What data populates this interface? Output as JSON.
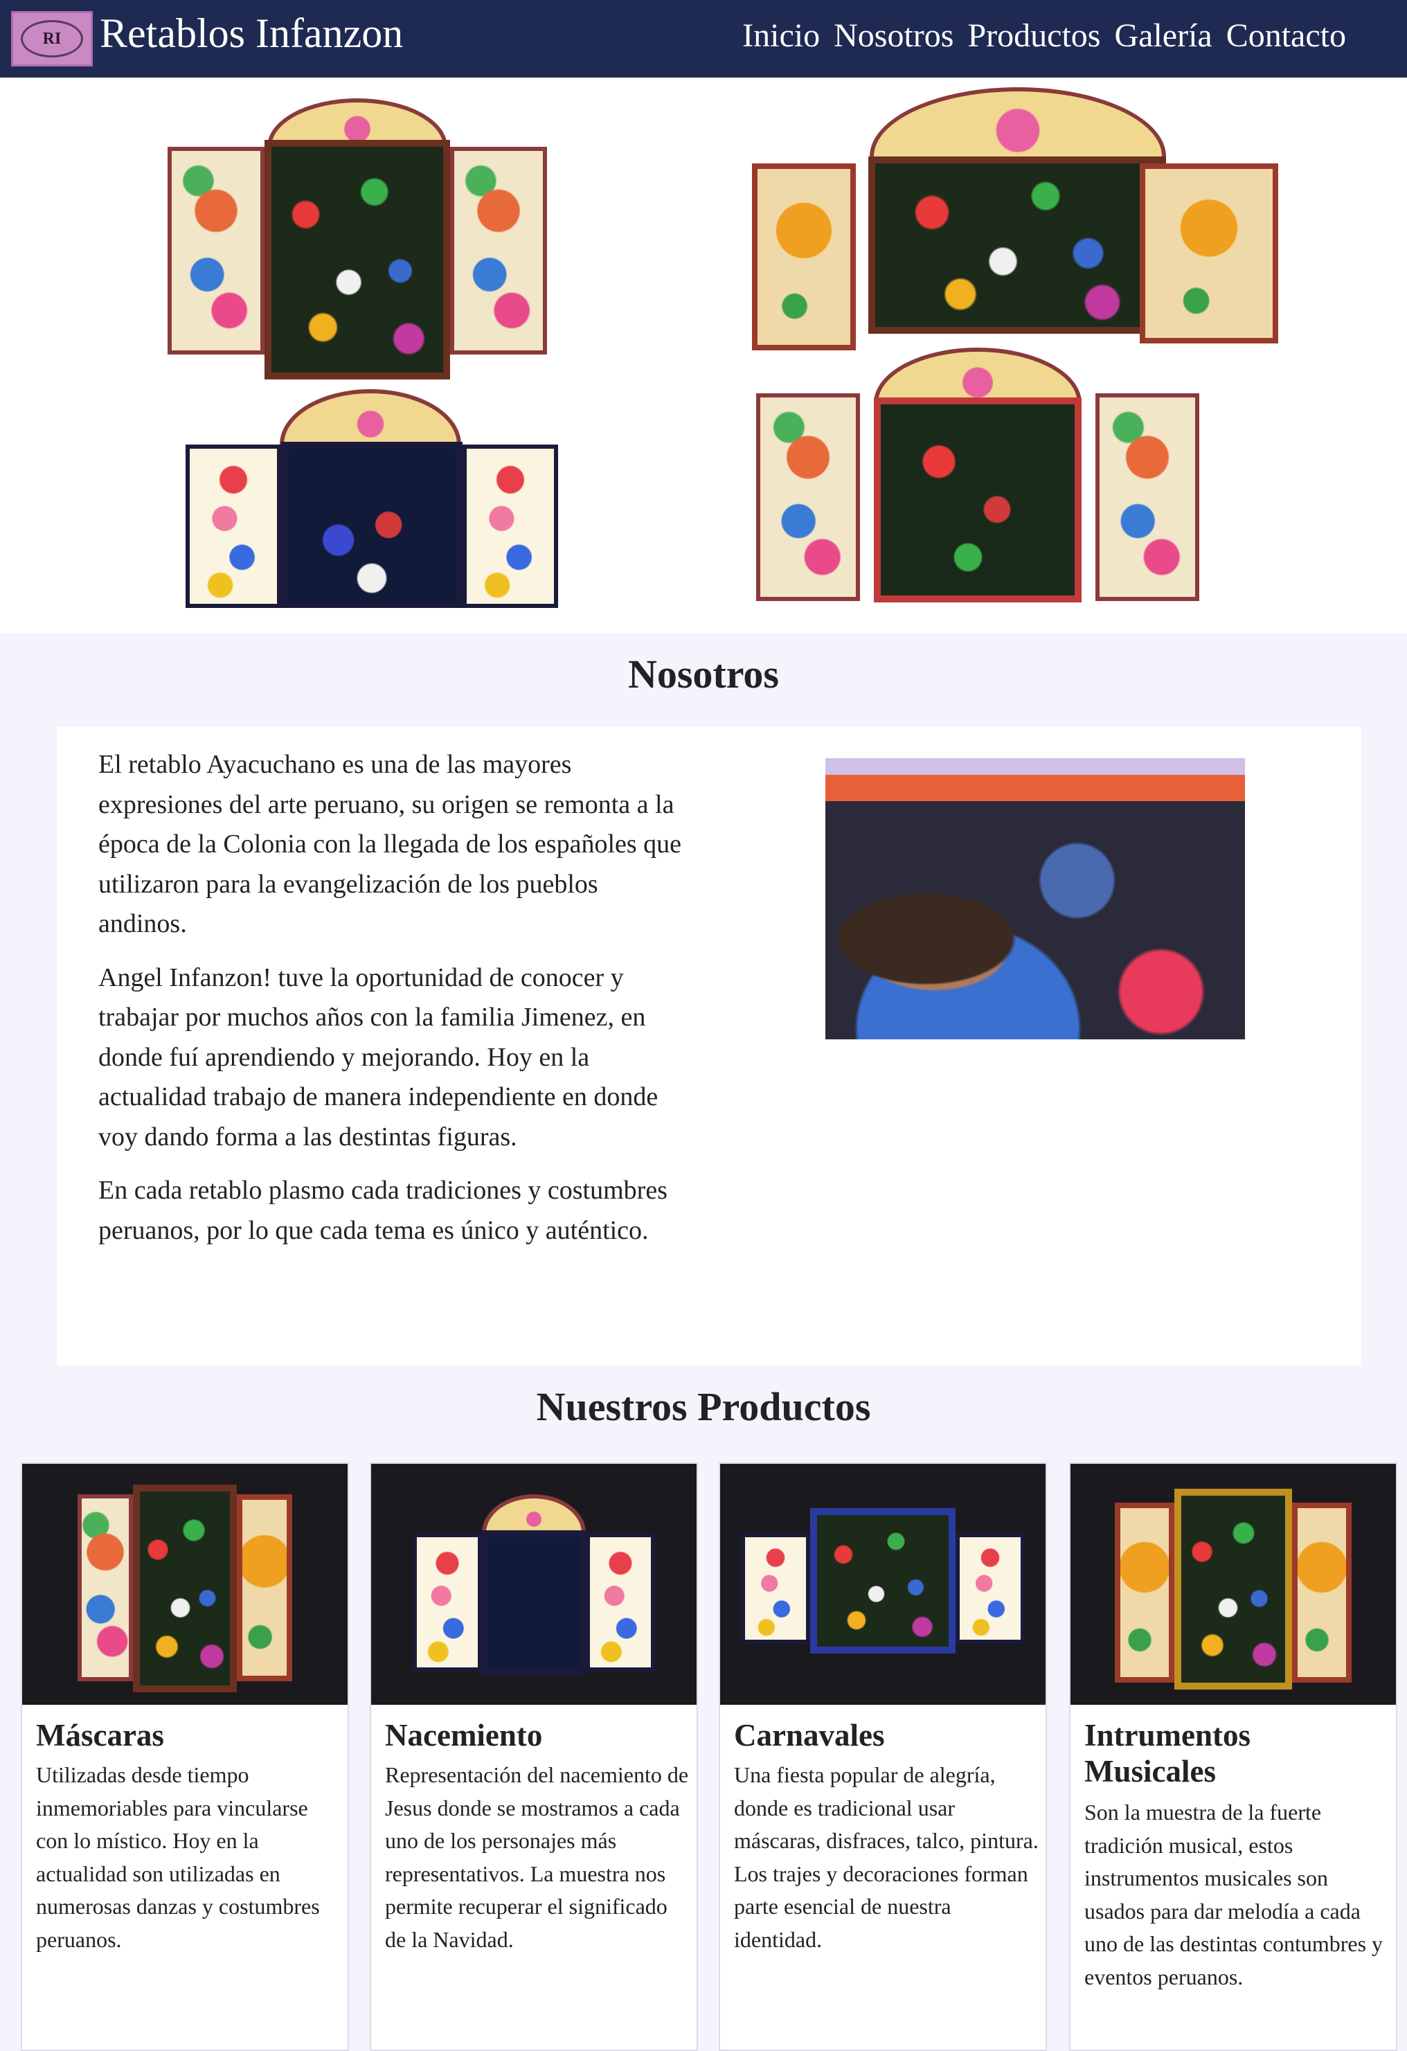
{
  "navbar": {
    "logo_text": "RI",
    "brand": "Retablos Infanzon",
    "links": [
      "Inicio",
      "Nosotros",
      "Productos",
      "Galería",
      "Contacto"
    ]
  },
  "about": {
    "title": "Nosotros",
    "paragraphs": [
      "El retablo Ayacuchano es una de las mayores expresiones del arte peruano, su origen se remonta a la época de la Colonia con la llegada de los españoles que utilizaron para la evangelización de los pueblos andinos.",
      "Angel Infanzon! tuve la oportunidad de conocer y trabajar por muchos años con la familia Jimenez, en donde fuí aprendiendo y mejorando. Hoy en la actualidad trabajo de manera independiente en donde voy dando forma a las destintas figuras.",
      "En cada retablo plasmo cada tradiciones y costumbres peruanos, por lo que cada tema es único y auténtico."
    ]
  },
  "products": {
    "title": "Nuestros Productos",
    "items": [
      {
        "title": "Máscaras",
        "text": "Utilizadas desde tiempo inmemoriables para vincularse con lo místico. Hoy en la actualidad son utilizadas en numerosas danzas y costumbres peruanos."
      },
      {
        "title": "Nacemiento",
        "text": "Representación del nacemiento de Jesus donde se mostramos a cada uno de los personajes más representativos. La muestra nos permite recuperar el significado de la Navidad."
      },
      {
        "title": "Carnavales",
        "text": "Una fiesta popular de alegría, donde es tradicional usar máscaras, disfraces, talco, pintura. Los trajes y decoraciones forman parte esencial de nuestra identidad."
      },
      {
        "title": "Intrumentos Musicales",
        "text": "Son la muestra de la fuerte tradición musical, estos instrumentos musicales son usados para dar melodía a cada uno de las destintas contumbres y eventos peruanos."
      }
    ]
  },
  "colors": {
    "navbar": "#1f2a52",
    "logo_bg": "#c98ac4",
    "page_bg": "#f4f4fc",
    "card_image_bg": "#1a1a1e"
  }
}
